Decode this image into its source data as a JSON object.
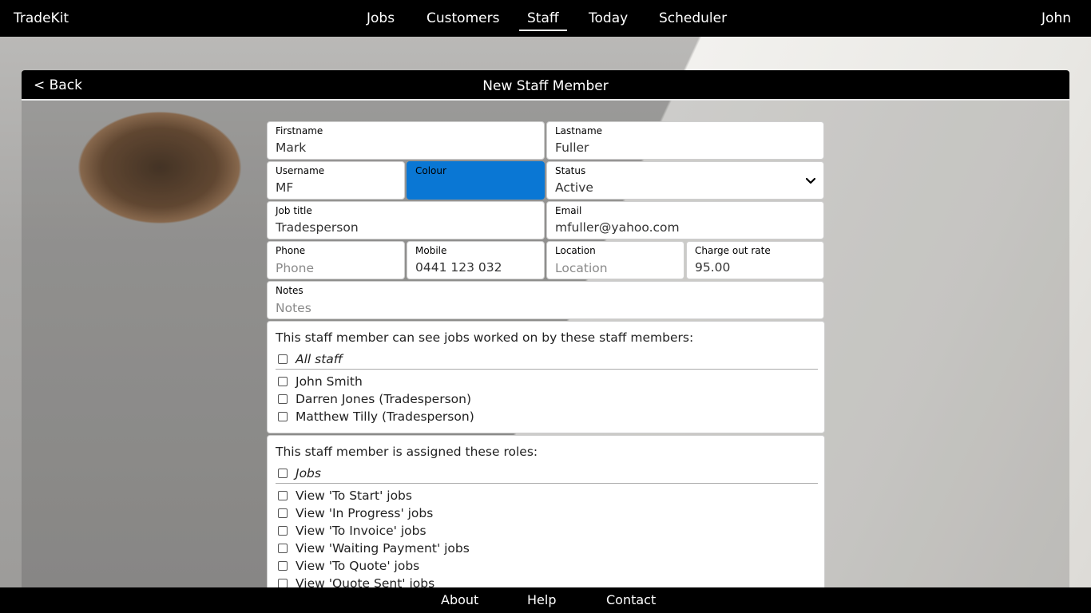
{
  "app": {
    "brand": "TradeKit",
    "user": "John"
  },
  "nav": {
    "items": [
      {
        "label": "Jobs"
      },
      {
        "label": "Customers"
      },
      {
        "label": "Staff"
      },
      {
        "label": "Today"
      },
      {
        "label": "Scheduler"
      }
    ],
    "active": "Staff"
  },
  "panel": {
    "back_label": "< Back",
    "title": "New Staff Member"
  },
  "form": {
    "firstname": {
      "label": "Firstname",
      "value": "Mark"
    },
    "lastname": {
      "label": "Lastname",
      "value": "Fuller"
    },
    "username": {
      "label": "Username",
      "value": "MF"
    },
    "colour": {
      "label": "Colour",
      "value": "#0a77d4"
    },
    "status": {
      "label": "Status",
      "value": "Active"
    },
    "job_title": {
      "label": "Job title",
      "value": "Tradesperson"
    },
    "email": {
      "label": "Email",
      "value": "mfuller@yahoo.com"
    },
    "phone": {
      "label": "Phone",
      "placeholder": "Phone"
    },
    "mobile": {
      "label": "Mobile",
      "value": "0441 123 032"
    },
    "location": {
      "label": "Location",
      "placeholder": "Location"
    },
    "charge_out_rate": {
      "label": "Charge out rate",
      "value": "95.00"
    },
    "notes": {
      "label": "Notes",
      "placeholder": "Notes"
    }
  },
  "visibility": {
    "heading": "This staff member can see jobs worked on by these staff members:",
    "all_label": "All staff",
    "staff": [
      {
        "label": "John Smith"
      },
      {
        "label": "Darren Jones (Tradesperson)"
      },
      {
        "label": "Matthew Tilly (Tradesperson)"
      }
    ]
  },
  "roles": {
    "heading": "This staff member is assigned these roles:",
    "group_label": "Jobs",
    "items": [
      {
        "label": "View 'To Start' jobs"
      },
      {
        "label": "View 'In Progress' jobs"
      },
      {
        "label": "View 'To Invoice' jobs"
      },
      {
        "label": "View 'Waiting Payment' jobs"
      },
      {
        "label": "View 'To Quote' jobs"
      },
      {
        "label": "View 'Quote Sent' jobs"
      }
    ]
  },
  "footer": {
    "items": [
      {
        "label": "About"
      },
      {
        "label": "Help"
      },
      {
        "label": "Contact"
      }
    ]
  }
}
